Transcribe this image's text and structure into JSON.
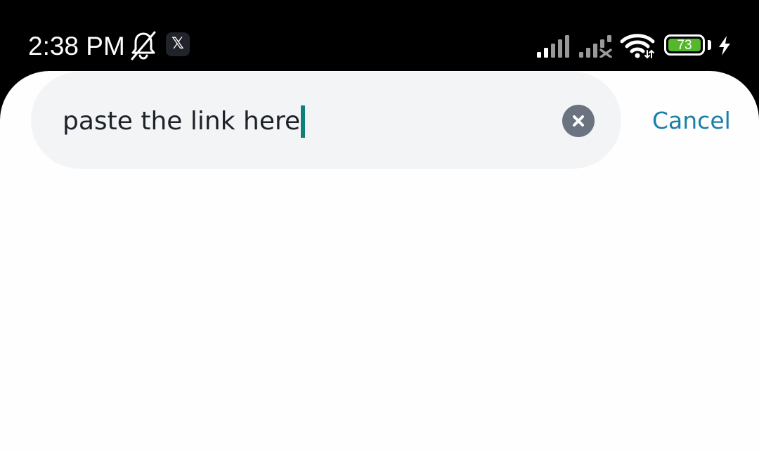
{
  "status_bar": {
    "time": "2:38 PM",
    "notification_icons": [
      "bell-off-icon",
      "x-app-icon"
    ],
    "x_app_glyph": "𝕏",
    "battery_level": "73",
    "battery_color": "#55b82b",
    "charging": true
  },
  "search": {
    "value": "paste the link here",
    "clear_icon": "close-icon",
    "caret_color": "#0f8076"
  },
  "actions": {
    "cancel_label": "Cancel",
    "cancel_color": "#1a7fa8"
  }
}
